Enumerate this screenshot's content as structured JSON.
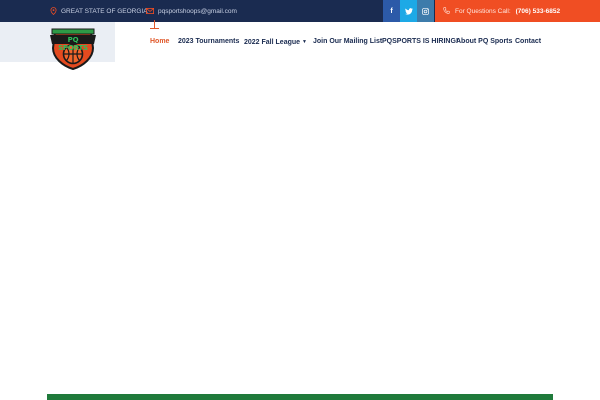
{
  "topbar": {
    "location": "GREAT STATE OF GEORGIA",
    "email": "pqsportshoops@gmail.com",
    "social": [
      {
        "label": "f",
        "icon": "facebook-icon"
      },
      {
        "label": "t",
        "icon": "twitter-icon"
      },
      {
        "label": "ig",
        "icon": "instagram-icon"
      }
    ],
    "call_label": "For Questions Call:",
    "phone": "(706) 533-6852"
  },
  "logo": {
    "text": "PQ SPORTS"
  },
  "nav": {
    "items": [
      {
        "label": "Home",
        "active": true
      },
      {
        "label": "2023 Tournaments"
      },
      {
        "label": "2022 Fall League",
        "has_dropdown": true
      },
      {
        "label": "Join Our Mailing List"
      },
      {
        "label": "PQSPORTS IS HIRING!"
      },
      {
        "label": "About PQ Sports"
      },
      {
        "label": "Contact"
      }
    ]
  },
  "colors": {
    "topbar": "#1a2b50",
    "accent": "#f04e23",
    "facebook": "#2c5aa8",
    "twitter": "#1da9e6",
    "instagram": "#3d7cab",
    "footer_strip": "#1f7a3b"
  }
}
